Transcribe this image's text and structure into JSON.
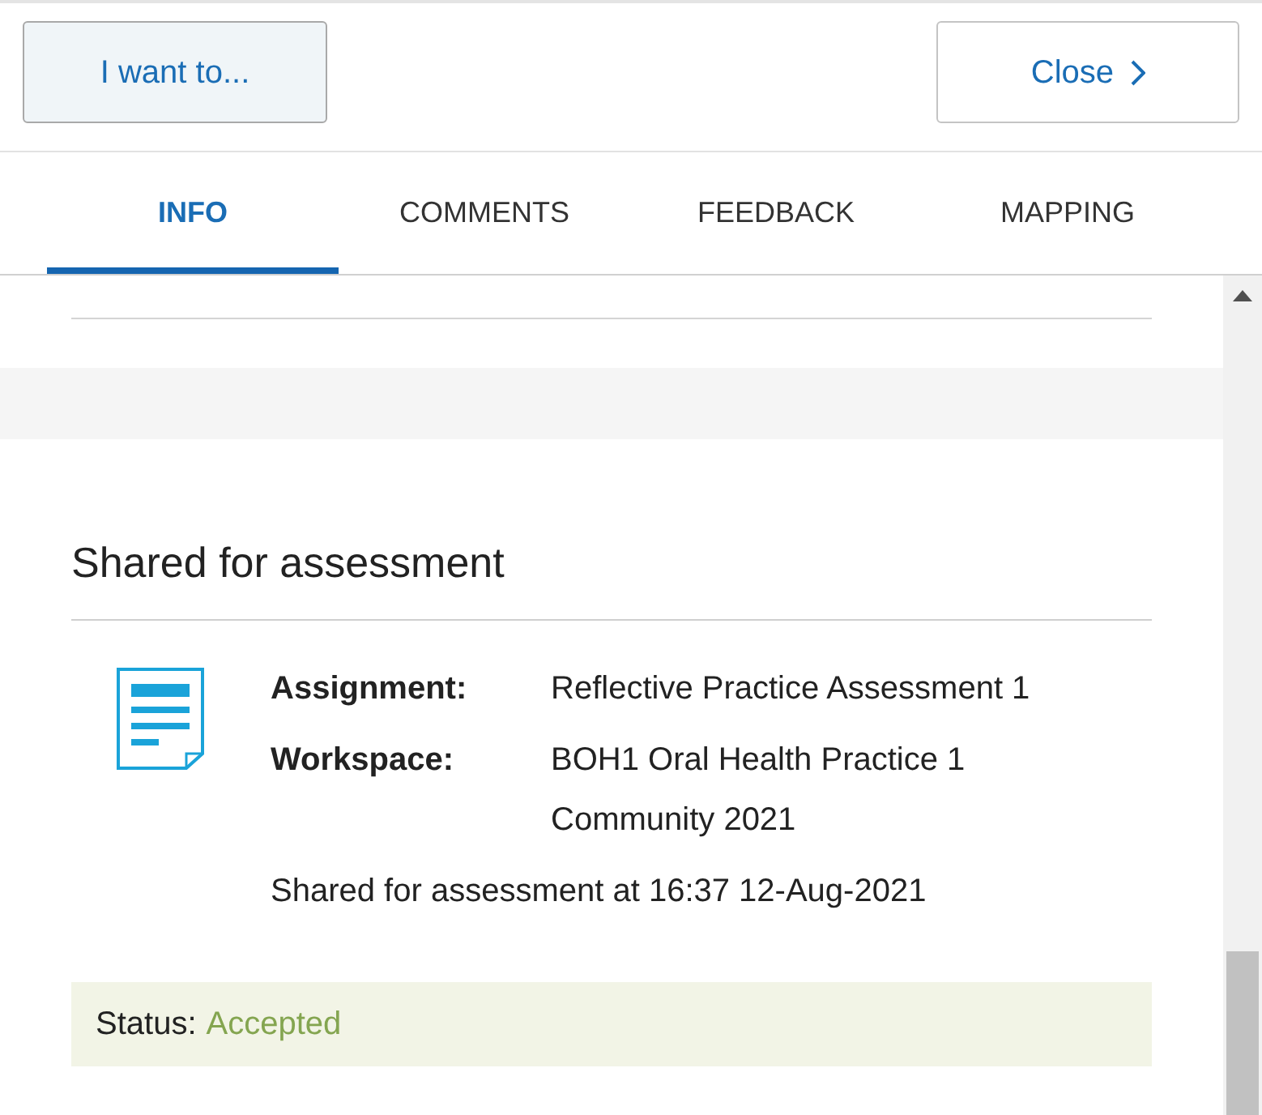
{
  "header": {
    "buttons": [
      {
        "label": "I want to...",
        "kind": "menu"
      },
      {
        "label": "Close",
        "kind": "close"
      }
    ]
  },
  "tabs": [
    {
      "label": "INFO",
      "selected": true
    },
    {
      "label": "COMMENTS",
      "selected": false
    },
    {
      "label": "FEEDBACK",
      "selected": false
    },
    {
      "label": "MAPPING",
      "selected": false
    }
  ],
  "section": {
    "title": "Shared for assessment",
    "fields": [
      {
        "label": "Assignment:",
        "value": "Reflective Practice Assessment 1"
      },
      {
        "label": "Workspace:",
        "value": "BOH1 Oral Health Practice 1 Community 2021"
      }
    ],
    "shared_note": "Shared for assessment at 16:37 12-Aug-2021",
    "status": {
      "label": "Status:",
      "value": "Accepted"
    }
  }
}
